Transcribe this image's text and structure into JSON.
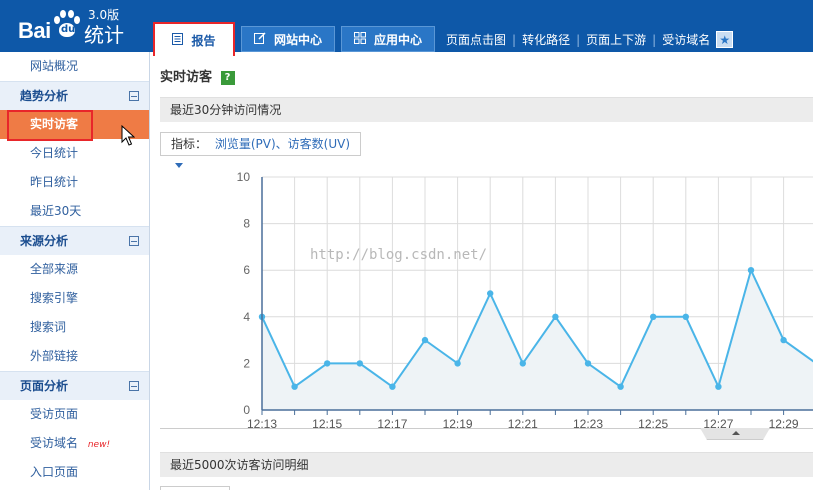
{
  "header": {
    "logo": {
      "bai": "Bai",
      "du": "du",
      "tongji": "统计",
      "version": "3.0版"
    },
    "tabs": [
      {
        "label": "报告",
        "icon": "report-icon"
      },
      {
        "label": "网站中心",
        "icon": "edit-icon"
      },
      {
        "label": "应用中心",
        "icon": "grid-icon"
      }
    ],
    "links": [
      "页面点击图",
      "转化路径",
      "页面上下游",
      "受访域名"
    ],
    "star_icon": "star-icon"
  },
  "sidebar": {
    "top_item": "网站概况",
    "groups": [
      {
        "title": "趋势分析",
        "items": [
          "实时访客",
          "今日统计",
          "昨日统计",
          "最近30天"
        ]
      },
      {
        "title": "来源分析",
        "items": [
          "全部来源",
          "搜索引擎",
          "搜索词",
          "外部链接"
        ]
      },
      {
        "title": "页面分析",
        "items": [
          "受访页面",
          "受访域名",
          "入口页面"
        ]
      }
    ],
    "active_item": "实时访客",
    "new_badge": "new!"
  },
  "main": {
    "title": "实时访客",
    "help": "?",
    "section1": "最近30分钟访问情况",
    "metric_label": "指标：",
    "metric_value": "浏览量(PV)、访客数(UV)",
    "section2": "最近5000次访客访问明细",
    "watermark": "http://blog.csdn.net/"
  },
  "chart_data": {
    "type": "area",
    "x": [
      "12:13",
      "12:14",
      "12:15",
      "12:16",
      "12:17",
      "12:18",
      "12:19",
      "12:20",
      "12:21",
      "12:22",
      "12:23",
      "12:24",
      "12:25",
      "12:26",
      "12:27",
      "12:28",
      "12:29",
      "12:30"
    ],
    "values": [
      4,
      1,
      2,
      2,
      1,
      3,
      2,
      5,
      2,
      4,
      2,
      1,
      4,
      4,
      1,
      6,
      3,
      2
    ],
    "x_tick_labels": [
      "12:13",
      "12:15",
      "12:17",
      "12:19",
      "12:21",
      "12:23",
      "12:25",
      "12:27",
      "12:29"
    ],
    "y_ticks": [
      0,
      2,
      4,
      6,
      8,
      10
    ],
    "ylim": [
      0,
      10
    ],
    "grid": true,
    "colors": {
      "line": "#4ab5e8",
      "fill": "#eef3f6",
      "grid": "#dcdcdc"
    }
  }
}
